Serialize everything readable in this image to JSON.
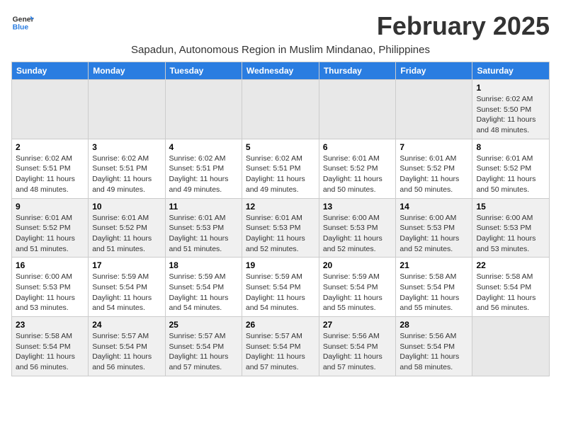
{
  "header": {
    "logo_line1": "General",
    "logo_line2": "Blue",
    "month_title": "February 2025",
    "subtitle": "Sapadun, Autonomous Region in Muslim Mindanao, Philippines"
  },
  "weekdays": [
    "Sunday",
    "Monday",
    "Tuesday",
    "Wednesday",
    "Thursday",
    "Friday",
    "Saturday"
  ],
  "weeks": [
    [
      {
        "day": "",
        "info": ""
      },
      {
        "day": "",
        "info": ""
      },
      {
        "day": "",
        "info": ""
      },
      {
        "day": "",
        "info": ""
      },
      {
        "day": "",
        "info": ""
      },
      {
        "day": "",
        "info": ""
      },
      {
        "day": "1",
        "info": "Sunrise: 6:02 AM\nSunset: 5:50 PM\nDaylight: 11 hours\nand 48 minutes."
      }
    ],
    [
      {
        "day": "2",
        "info": "Sunrise: 6:02 AM\nSunset: 5:51 PM\nDaylight: 11 hours\nand 48 minutes."
      },
      {
        "day": "3",
        "info": "Sunrise: 6:02 AM\nSunset: 5:51 PM\nDaylight: 11 hours\nand 49 minutes."
      },
      {
        "day": "4",
        "info": "Sunrise: 6:02 AM\nSunset: 5:51 PM\nDaylight: 11 hours\nand 49 minutes."
      },
      {
        "day": "5",
        "info": "Sunrise: 6:02 AM\nSunset: 5:51 PM\nDaylight: 11 hours\nand 49 minutes."
      },
      {
        "day": "6",
        "info": "Sunrise: 6:01 AM\nSunset: 5:52 PM\nDaylight: 11 hours\nand 50 minutes."
      },
      {
        "day": "7",
        "info": "Sunrise: 6:01 AM\nSunset: 5:52 PM\nDaylight: 11 hours\nand 50 minutes."
      },
      {
        "day": "8",
        "info": "Sunrise: 6:01 AM\nSunset: 5:52 PM\nDaylight: 11 hours\nand 50 minutes."
      }
    ],
    [
      {
        "day": "9",
        "info": "Sunrise: 6:01 AM\nSunset: 5:52 PM\nDaylight: 11 hours\nand 51 minutes."
      },
      {
        "day": "10",
        "info": "Sunrise: 6:01 AM\nSunset: 5:52 PM\nDaylight: 11 hours\nand 51 minutes."
      },
      {
        "day": "11",
        "info": "Sunrise: 6:01 AM\nSunset: 5:53 PM\nDaylight: 11 hours\nand 51 minutes."
      },
      {
        "day": "12",
        "info": "Sunrise: 6:01 AM\nSunset: 5:53 PM\nDaylight: 11 hours\nand 52 minutes."
      },
      {
        "day": "13",
        "info": "Sunrise: 6:00 AM\nSunset: 5:53 PM\nDaylight: 11 hours\nand 52 minutes."
      },
      {
        "day": "14",
        "info": "Sunrise: 6:00 AM\nSunset: 5:53 PM\nDaylight: 11 hours\nand 52 minutes."
      },
      {
        "day": "15",
        "info": "Sunrise: 6:00 AM\nSunset: 5:53 PM\nDaylight: 11 hours\nand 53 minutes."
      }
    ],
    [
      {
        "day": "16",
        "info": "Sunrise: 6:00 AM\nSunset: 5:53 PM\nDaylight: 11 hours\nand 53 minutes."
      },
      {
        "day": "17",
        "info": "Sunrise: 5:59 AM\nSunset: 5:54 PM\nDaylight: 11 hours\nand 54 minutes."
      },
      {
        "day": "18",
        "info": "Sunrise: 5:59 AM\nSunset: 5:54 PM\nDaylight: 11 hours\nand 54 minutes."
      },
      {
        "day": "19",
        "info": "Sunrise: 5:59 AM\nSunset: 5:54 PM\nDaylight: 11 hours\nand 54 minutes."
      },
      {
        "day": "20",
        "info": "Sunrise: 5:59 AM\nSunset: 5:54 PM\nDaylight: 11 hours\nand 55 minutes."
      },
      {
        "day": "21",
        "info": "Sunrise: 5:58 AM\nSunset: 5:54 PM\nDaylight: 11 hours\nand 55 minutes."
      },
      {
        "day": "22",
        "info": "Sunrise: 5:58 AM\nSunset: 5:54 PM\nDaylight: 11 hours\nand 56 minutes."
      }
    ],
    [
      {
        "day": "23",
        "info": "Sunrise: 5:58 AM\nSunset: 5:54 PM\nDaylight: 11 hours\nand 56 minutes."
      },
      {
        "day": "24",
        "info": "Sunrise: 5:57 AM\nSunset: 5:54 PM\nDaylight: 11 hours\nand 56 minutes."
      },
      {
        "day": "25",
        "info": "Sunrise: 5:57 AM\nSunset: 5:54 PM\nDaylight: 11 hours\nand 57 minutes."
      },
      {
        "day": "26",
        "info": "Sunrise: 5:57 AM\nSunset: 5:54 PM\nDaylight: 11 hours\nand 57 minutes."
      },
      {
        "day": "27",
        "info": "Sunrise: 5:56 AM\nSunset: 5:54 PM\nDaylight: 11 hours\nand 57 minutes."
      },
      {
        "day": "28",
        "info": "Sunrise: 5:56 AM\nSunset: 5:54 PM\nDaylight: 11 hours\nand 58 minutes."
      },
      {
        "day": "",
        "info": ""
      }
    ]
  ]
}
